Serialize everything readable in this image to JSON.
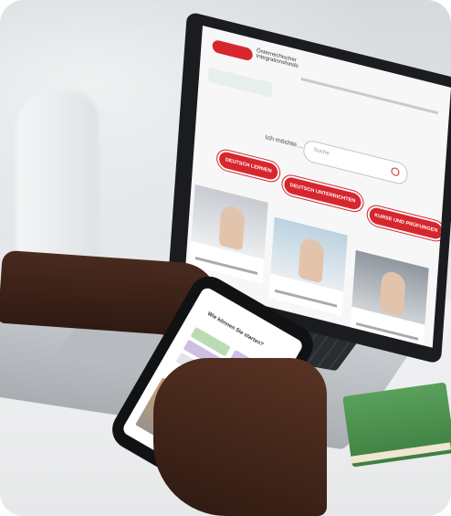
{
  "scene": {
    "laptop_site": {
      "brand": "Österreichischer Integrationsfonds",
      "search_prompt": "Ich möchte…",
      "search_placeholder": "Suche",
      "buttons": [
        "DEUTSCH LERNEN",
        "DEUTSCH UNTERRICHTEN",
        "KURSE UND PRÜFUNGEN"
      ]
    },
    "phone_site": {
      "heading": "Wie können Sie starten?"
    },
    "colors": {
      "brand_red": "#d7262e",
      "book_green": "#4a8f4c",
      "phone_chip_green": "#b9dcb3",
      "phone_chip_purple": "#cdbfe3"
    }
  }
}
